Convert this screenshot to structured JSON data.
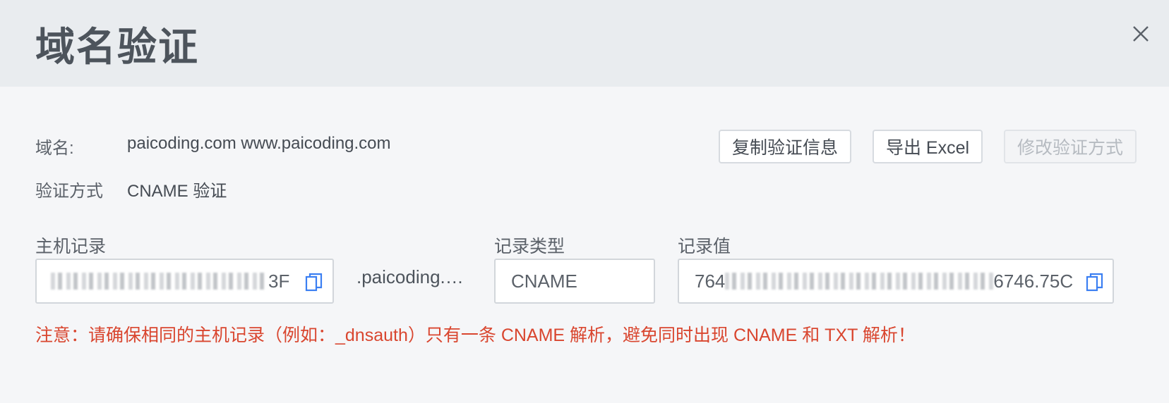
{
  "dialog": {
    "title": "域名验证",
    "close_icon": "close-icon"
  },
  "info": {
    "domain_label": "域名:",
    "domain_value": "paicoding.com www.paicoding.com",
    "method_label": "验证方式",
    "method_value": "CNAME 验证"
  },
  "actions": {
    "copy_label": "复制验证信息",
    "export_label": "导出 Excel",
    "modify_label": "修改验证方式"
  },
  "record": {
    "host_label": "主机记录",
    "host_value_tail": "3F",
    "host_suffix": ".paicoding.…",
    "type_label": "记录类型",
    "type_value": "CNAME",
    "value_label": "记录值",
    "value_head": "764",
    "value_tail": "6746.75C"
  },
  "notice": "注意：请确保相同的主机记录（例如：_dnsauth）只有一条 CNAME 解析，避免同时出现 CNAME 和 TXT 解析！",
  "colors": {
    "warning": "#d9462f",
    "copy_icon": "#3b7ff2"
  }
}
